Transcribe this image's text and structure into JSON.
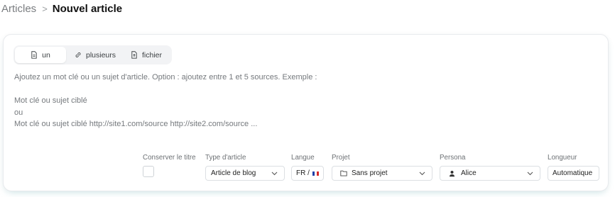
{
  "breadcrumb": {
    "parent": "Articles",
    "separator": ">",
    "current": "Nouvel article"
  },
  "tabs": [
    {
      "label": "un",
      "icon": "document-icon",
      "active": true
    },
    {
      "label": "plusieurs",
      "icon": "link-icon",
      "active": false
    },
    {
      "label": "fichier",
      "icon": "file-upload-icon",
      "active": false
    }
  ],
  "prompt": {
    "placeholder": "Ajoutez un mot clé ou un sujet d'article. Option : ajoutez entre 1 et 5 sources. Exemple :\n\nMot clé ou sujet ciblé\nou\nMot clé ou sujet ciblé http://site1.com/source http://site2.com/source ..."
  },
  "settings": {
    "keep_title": {
      "label": "Conserver le titre",
      "checked": false
    },
    "article_type": {
      "label": "Type d'article",
      "value": "Article de blog"
    },
    "language": {
      "label": "Langue",
      "value": "FR /",
      "flag": "fr-flag-icon"
    },
    "project": {
      "label": "Projet",
      "value": "Sans projet",
      "icon": "folder-icon"
    },
    "persona": {
      "label": "Persona",
      "value": "Alice",
      "icon": "person-icon"
    },
    "length": {
      "label": "Longueur",
      "value": "Automatique"
    }
  },
  "colors": {
    "card_border": "#e8eaed",
    "tab_bg": "#f2f3f5",
    "glow": "#5ab9c8"
  }
}
